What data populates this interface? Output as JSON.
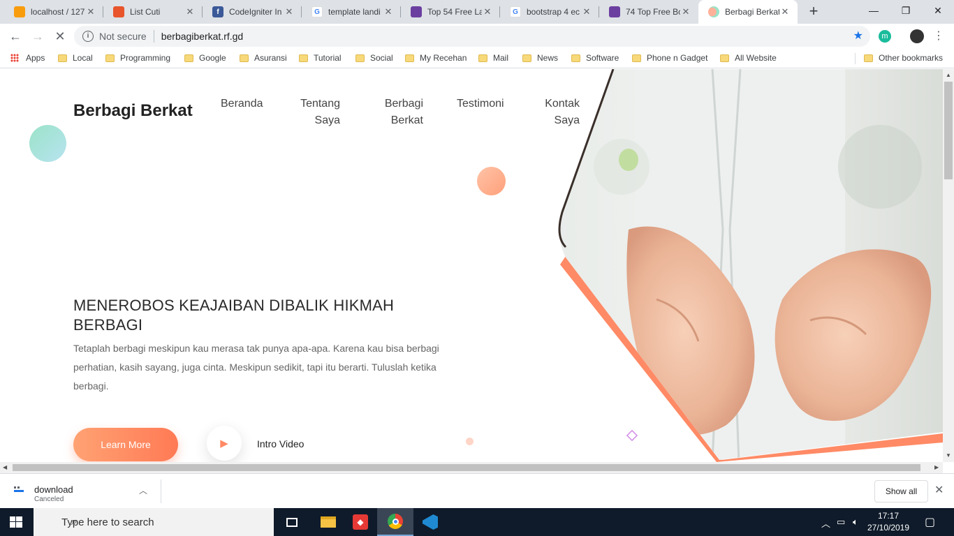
{
  "browser": {
    "tabs": [
      {
        "title": "localhost / 127",
        "favicon": "phpmyadmin-icon",
        "color": "#f89c0e",
        "active": false
      },
      {
        "title": "List Cuti",
        "favicon": "codeigniter-icon",
        "color": "#e8542b",
        "active": false
      },
      {
        "title": "CodeIgniter In",
        "favicon": "facebook-icon",
        "color": "#3b5998",
        "active": false
      },
      {
        "title": "template landi",
        "favicon": "google-icon",
        "color": "#4285f4",
        "active": false
      },
      {
        "title": "Top 54 Free La",
        "favicon": "colorlib-icon",
        "color": "#6b3fa0",
        "active": false
      },
      {
        "title": "bootstrap 4 ec",
        "favicon": "google-icon",
        "color": "#4285f4",
        "active": false
      },
      {
        "title": "74 Top Free Bo",
        "favicon": "colorlib-icon",
        "color": "#6b3fa0",
        "active": false
      },
      {
        "title": "Berbagi Berkat",
        "favicon": "site-icon",
        "color": "#ff8a65",
        "active": true
      }
    ],
    "security_label": "Not secure",
    "url": "berbagiberkat.rf.gd",
    "extension_label": "m",
    "bookmarks": [
      {
        "label": "Apps",
        "icon": "apps-grid-icon"
      },
      {
        "label": "Local",
        "icon": "folder-icon"
      },
      {
        "label": "Programming",
        "icon": "folder-icon"
      },
      {
        "label": "Google",
        "icon": "folder-icon"
      },
      {
        "label": "Asuransi",
        "icon": "folder-icon"
      },
      {
        "label": "Tutorial",
        "icon": "folder-icon"
      },
      {
        "label": "Social",
        "icon": "folder-icon"
      },
      {
        "label": "My Recehan",
        "icon": "folder-icon"
      },
      {
        "label": "Mail",
        "icon": "folder-icon"
      },
      {
        "label": "News",
        "icon": "folder-icon"
      },
      {
        "label": "Software",
        "icon": "folder-icon"
      },
      {
        "label": "Phone n Gadget",
        "icon": "folder-icon"
      },
      {
        "label": "All Website",
        "icon": "folder-icon"
      }
    ],
    "other_bookmarks": "Other bookmarks"
  },
  "page": {
    "brand": "Berbagi Berkat",
    "nav": [
      {
        "line1": "Beranda",
        "line2": ""
      },
      {
        "line1": "Tentang",
        "line2": "Saya"
      },
      {
        "line1": "Berbagi",
        "line2": "Berkat"
      },
      {
        "line1": "Testimoni",
        "line2": ""
      },
      {
        "line1": "Kontak",
        "line2": "Saya"
      }
    ],
    "hero_title": "MENEROBOS KEAJAIBAN DIBALIK HIKMAH BERBAGI",
    "hero_text": "Tetaplah berbagi meskipun kau merasa tak punya apa-apa. Karena kau bisa berbagi perhatian, kasih sayang, juga cinta. Meskipun sedikit, tapi itu berarti. Tuluslah ketika berbagi.",
    "learn_more": "Learn More",
    "intro_video": "Intro Video",
    "colors": {
      "accent": "#ff7a55",
      "accent_light": "#ffa273",
      "mint": "#9be3c8"
    }
  },
  "download_shelf": {
    "file_name": "download",
    "status": "Canceled",
    "show_all": "Show all"
  },
  "taskbar": {
    "search_placeholder": "Type here to search",
    "time": "17:17",
    "date": "27/10/2019"
  }
}
